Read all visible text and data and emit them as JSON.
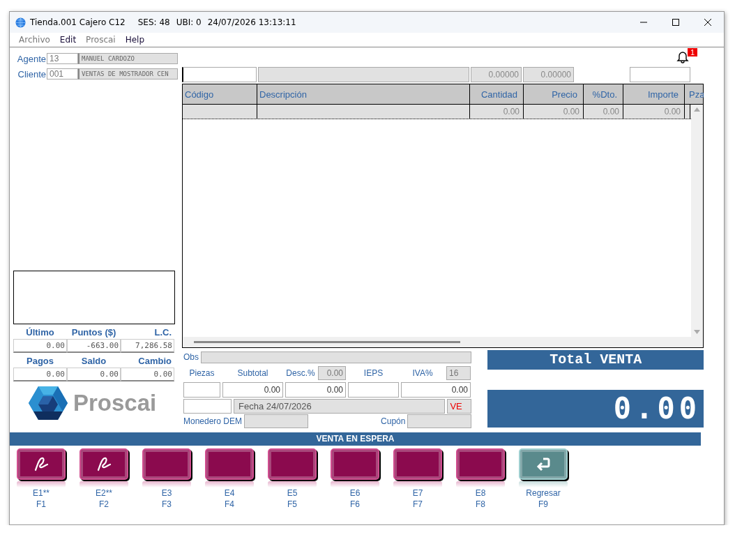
{
  "window": {
    "title": "Tienda.001  Cajero C12",
    "session": "SES: 48",
    "location": "UBI: 0",
    "datetime": "24/07/2026 13:13:11"
  },
  "menu": [
    {
      "label": "Archivo",
      "disabled": true
    },
    {
      "label": "Edit",
      "disabled": false
    },
    {
      "label": "Proscai",
      "disabled": true
    },
    {
      "label": "Help",
      "disabled": false
    }
  ],
  "notifications": {
    "count": "1"
  },
  "agent": {
    "label": "Agente",
    "code": "13",
    "name": "MANUEL CARDOZO"
  },
  "client": {
    "label": "Cliente",
    "code": "001",
    "name": "VENTAS DE MOSTRADOR CEN"
  },
  "entry_bar": {
    "value_1": "0.00000",
    "value_2": "0.00000"
  },
  "table": {
    "columns": [
      "Código",
      "Descripción",
      "Cantidad",
      "Precio",
      "%Dto.",
      "Importe",
      "Pza"
    ],
    "rows": [
      {
        "cells": [
          null,
          null,
          "0.00",
          "0.00",
          "0.00",
          "0.00"
        ]
      }
    ]
  },
  "account": [
    {
      "label": "Último",
      "value": "0.00"
    },
    {
      "label": "Puntos ($)",
      "value": "-663.00"
    },
    {
      "label": "L.C.",
      "value": "7,286.58"
    }
  ],
  "payment": [
    {
      "label": "Pagos",
      "value": "0.00"
    },
    {
      "label": "Saldo",
      "value": "0.00"
    },
    {
      "label": "Cambio",
      "value": "0.00"
    }
  ],
  "logo": {
    "text": "Proscai"
  },
  "summary": {
    "obs_label": "Obs",
    "piezas_label": "Piezas",
    "subtotal_label": "Subtotal",
    "desc_label": "Desc.%",
    "desc_value": "0.00",
    "ieps_label": "IEPS",
    "iva_label": "IVA%",
    "iva_value": "16",
    "subtotal": "0.00",
    "discount": "0.00",
    "iva": "0.00",
    "date": "Fecha 24/07/2026",
    "doc_type": "VE",
    "monedero_label": "Monedero DEM",
    "cupon_label": "Cupón"
  },
  "total": {
    "title": "Total VENTA",
    "amount": "0.00"
  },
  "hold_bar": {
    "title": "VENTA EN ESPERA"
  },
  "function_keys": [
    {
      "label": "E1**",
      "key": "F1",
      "kind": "sign"
    },
    {
      "label": "E2**",
      "key": "F2",
      "kind": "sign"
    },
    {
      "label": "E3",
      "key": "F3",
      "kind": "blank"
    },
    {
      "label": "E4",
      "key": "F4",
      "kind": "blank"
    },
    {
      "label": "E5",
      "key": "F5",
      "kind": "blank"
    },
    {
      "label": "E6",
      "key": "F6",
      "kind": "blank"
    },
    {
      "label": "E7",
      "key": "F7",
      "kind": "blank"
    },
    {
      "label": "E8",
      "key": "F8",
      "kind": "blank"
    },
    {
      "label": "Regresar",
      "key": "F9",
      "kind": "back"
    }
  ]
}
